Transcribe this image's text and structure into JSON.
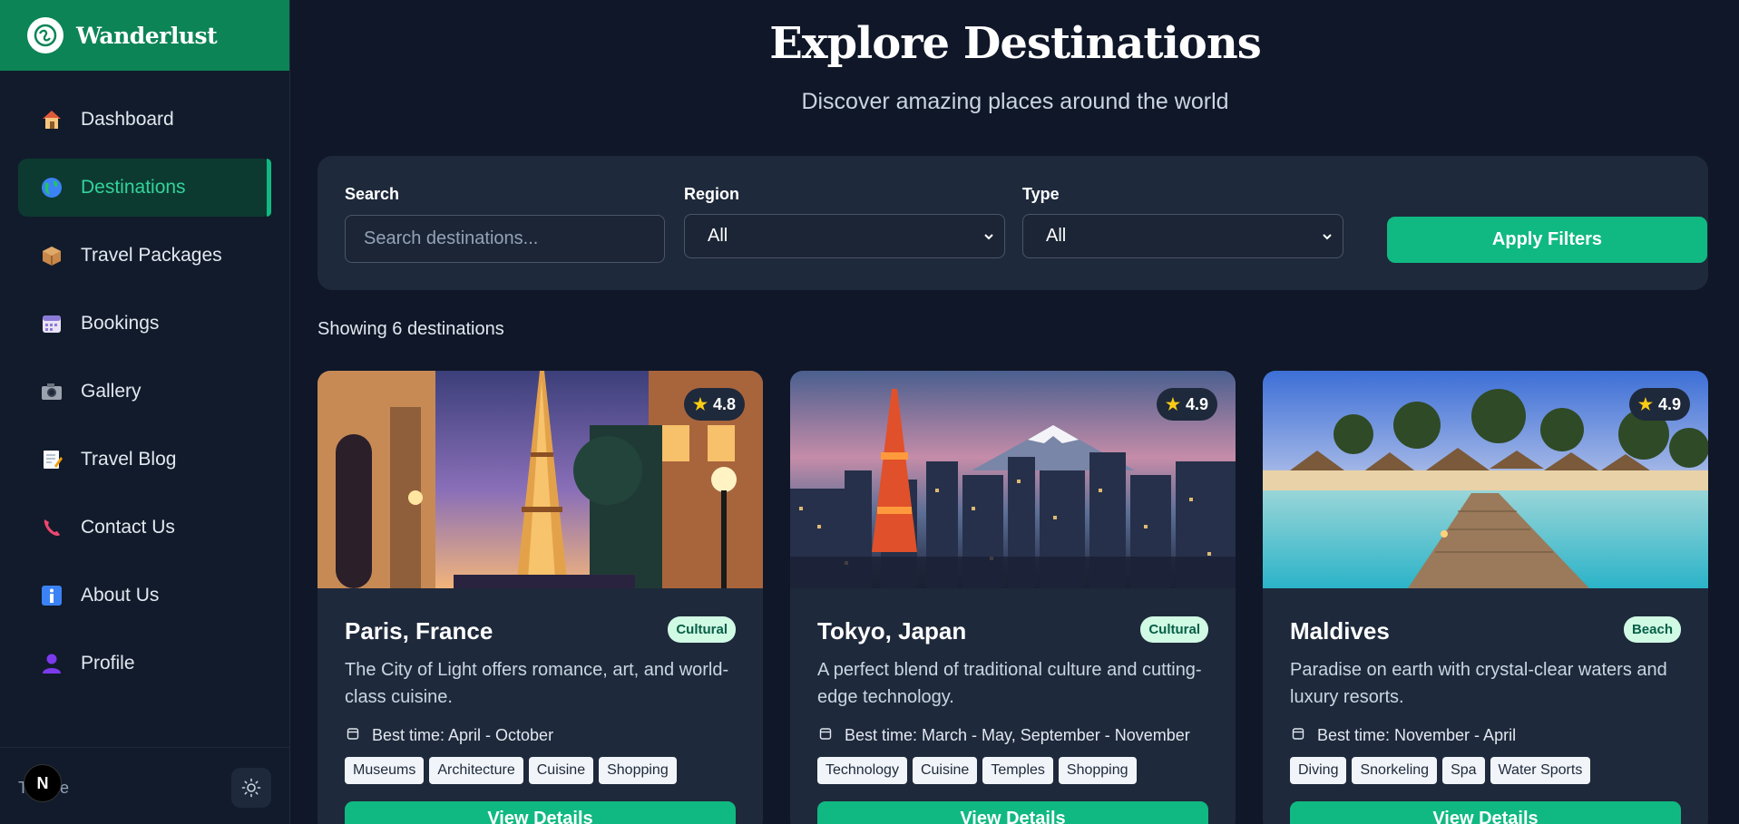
{
  "brand": {
    "name": "Wanderlust"
  },
  "nav": [
    {
      "label": "Dashboard",
      "icon": "house-icon"
    },
    {
      "label": "Destinations",
      "icon": "globe-icon",
      "active": true
    },
    {
      "label": "Travel Packages",
      "icon": "package-icon"
    },
    {
      "label": "Bookings",
      "icon": "calendar-icon"
    },
    {
      "label": "Gallery",
      "icon": "camera-icon"
    },
    {
      "label": "Travel Blog",
      "icon": "memo-icon"
    },
    {
      "label": "Contact Us",
      "icon": "phone-icon"
    },
    {
      "label": "About Us",
      "icon": "info-icon"
    },
    {
      "label": "Profile",
      "icon": "user-icon"
    }
  ],
  "sidebar_footer": {
    "theme_label": "Theme",
    "badge": "N"
  },
  "header": {
    "title": "Explore Destinations",
    "subtitle": "Discover amazing places around the world"
  },
  "filters": {
    "search_label": "Search",
    "search_placeholder": "Search destinations...",
    "region_label": "Region",
    "region_value": "All",
    "type_label": "Type",
    "type_value": "All",
    "apply_label": "Apply Filters"
  },
  "results": {
    "summary": "Showing 6 destinations"
  },
  "cards": [
    {
      "title": "Paris, France",
      "rating": "4.8",
      "type": "Cultural",
      "description": "The City of Light offers romance, art, and world-class cuisine.",
      "best_time": "Best time: April - October",
      "tags": [
        "Museums",
        "Architecture",
        "Cuisine",
        "Shopping"
      ],
      "button": "View Details"
    },
    {
      "title": "Tokyo, Japan",
      "rating": "4.9",
      "type": "Cultural",
      "description": "A perfect blend of traditional culture and cutting-edge technology.",
      "best_time": "Best time: March - May, September - November",
      "tags": [
        "Technology",
        "Cuisine",
        "Temples",
        "Shopping"
      ],
      "button": "View Details"
    },
    {
      "title": "Maldives",
      "rating": "4.9",
      "type": "Beach",
      "description": "Paradise on earth with crystal-clear waters and luxury resorts.",
      "best_time": "Best time: November - April",
      "tags": [
        "Diving",
        "Snorkeling",
        "Spa",
        "Water Sports"
      ],
      "button": "View Details"
    }
  ],
  "colors": {
    "accent": "#10b981",
    "brand_bar": "#0c8456",
    "background": "#0f1728",
    "panel": "#1e293b"
  }
}
